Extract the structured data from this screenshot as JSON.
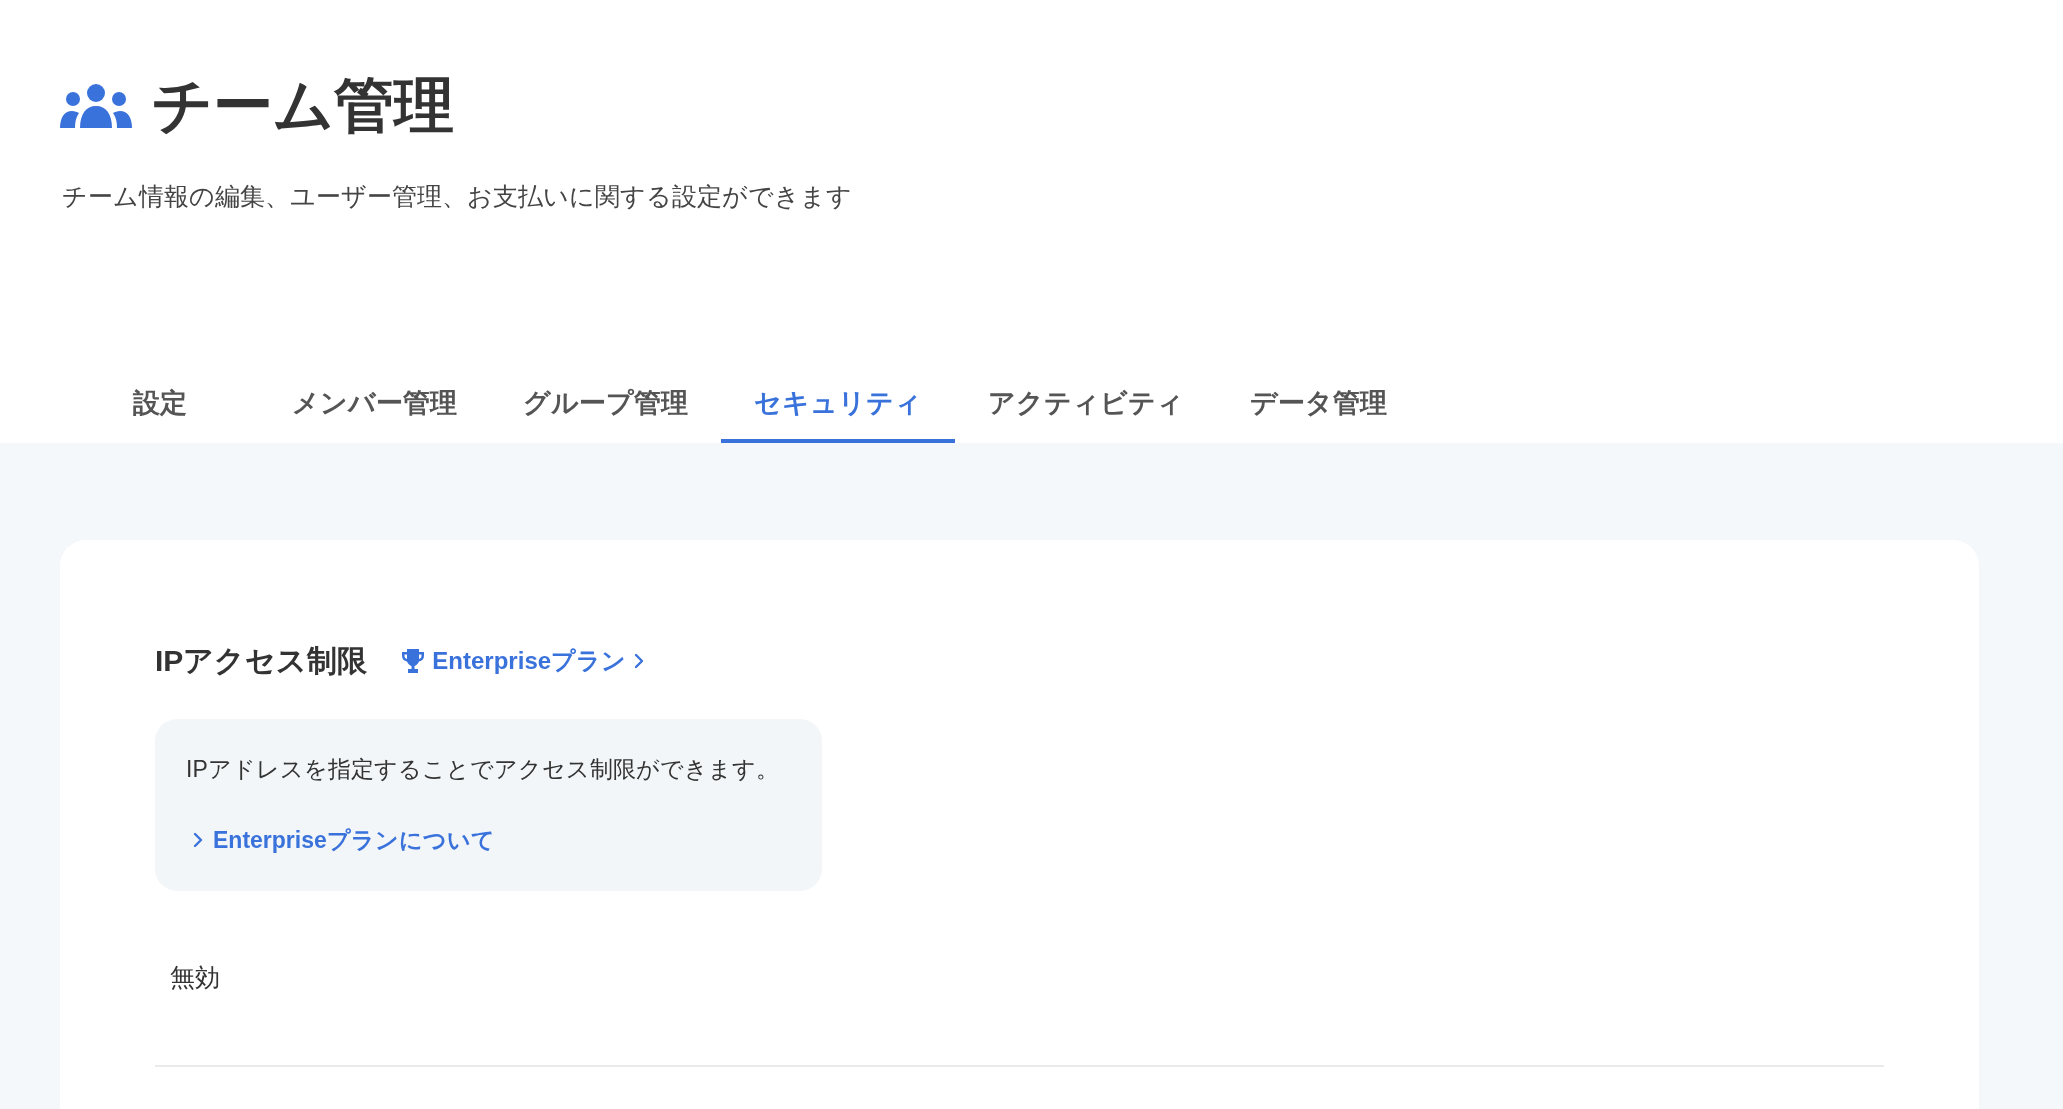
{
  "header": {
    "title": "チーム管理",
    "description": "チーム情報の編集、ユーザー管理、お支払いに関する設定ができます"
  },
  "tabs": [
    {
      "label": "設定",
      "selected": false
    },
    {
      "label": "メンバー管理",
      "selected": false
    },
    {
      "label": "グループ管理",
      "selected": false
    },
    {
      "label": "セキュリティ",
      "selected": true
    },
    {
      "label": "アクティビティ",
      "selected": false
    },
    {
      "label": "データ管理",
      "selected": false
    }
  ],
  "section": {
    "title": "IPアクセス制限",
    "plan_badge": "Enterpriseプラン",
    "info": {
      "text": "IPアドレスを指定することでアクセス制限ができます。",
      "link": "Enterpriseプランについて"
    },
    "status": "無効"
  }
}
